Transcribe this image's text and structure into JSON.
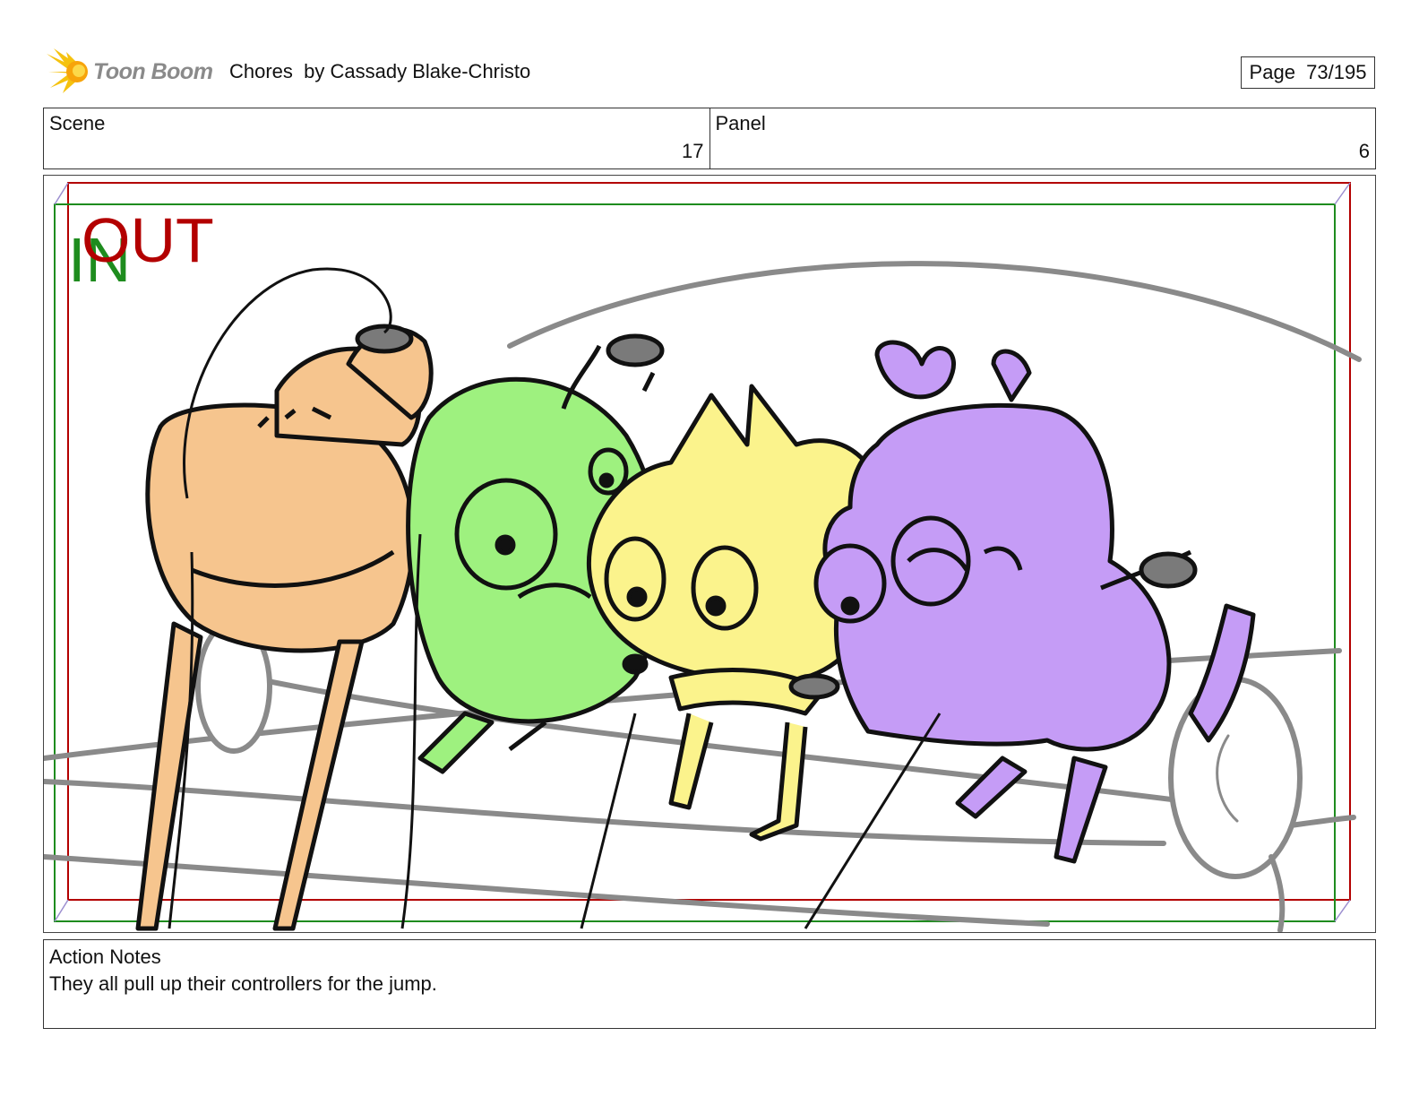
{
  "header": {
    "logo_text": "Toon Boom",
    "title": "Chores  by Cassady Blake-Christo",
    "page_label": "Page  73/195"
  },
  "info": {
    "scene_label": "Scene",
    "scene_value": "17",
    "panel_label": "Panel",
    "panel_value": "6"
  },
  "frame": {
    "out_label": "OUT",
    "in_label": "IN",
    "out_color": "#b30000",
    "in_color": "#1e8c1e"
  },
  "notes": {
    "label": "Action Notes",
    "text": "They all pull up their controllers for the jump."
  },
  "colors": {
    "orange_character": "#f6c58e",
    "green_character": "#9ef17f",
    "yellow_character": "#fbf38c",
    "purple_character": "#c59cf6",
    "couch_lines": "#8a8a8a"
  }
}
